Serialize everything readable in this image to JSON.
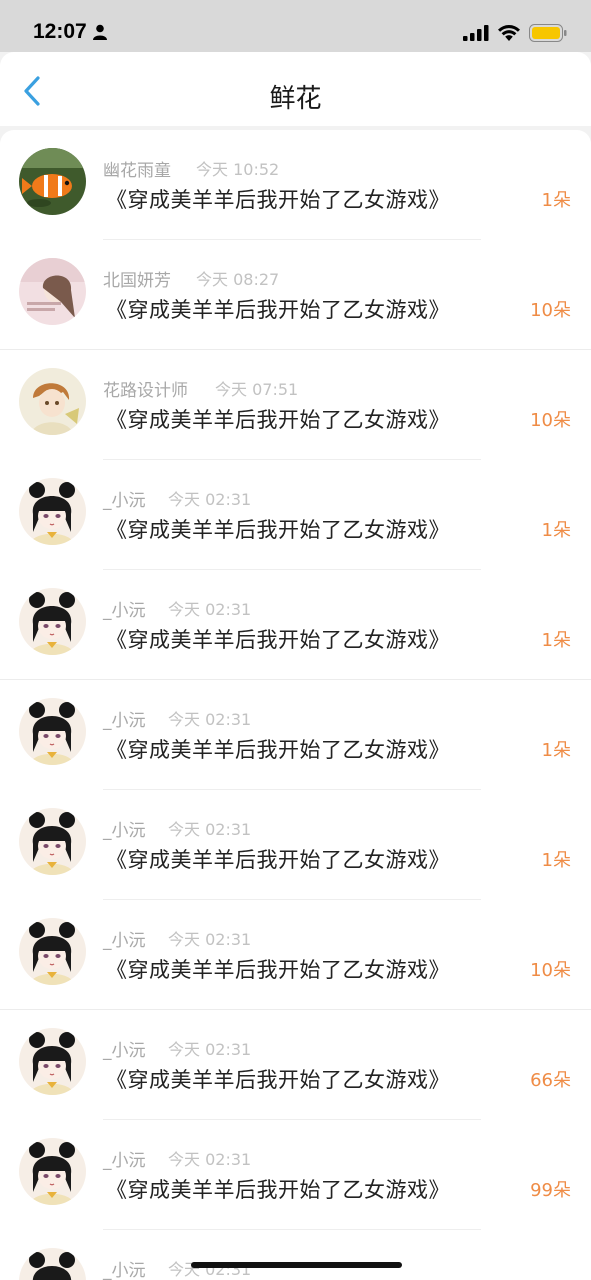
{
  "status_bar": {
    "time": "12:07"
  },
  "header": {
    "title": "鲜花"
  },
  "colors": {
    "accent": "#3aa0e0",
    "count": "#ef8c46"
  },
  "items": [
    {
      "user": "幽花雨童",
      "time": "今天 10:52",
      "book": "《穿成美羊羊后我开始了乙女游戏》",
      "count": "1朵",
      "avatar": "fish"
    },
    {
      "user": "北国妍芳",
      "time": "今天 08:27",
      "book": "《穿成美羊羊后我开始了乙女游戏》",
      "count": "10朵",
      "avatar": "girl-pink"
    },
    {
      "user": "花路设计师",
      "time": "今天 07:51",
      "book": "《穿成美羊羊后我开始了乙女游戏》",
      "count": "10朵",
      "avatar": "boy-anime"
    },
    {
      "user": "_小沅",
      "time": "今天 02:31",
      "book": "《穿成美羊羊后我开始了乙女游戏》",
      "count": "1朵",
      "avatar": "girl-anime"
    },
    {
      "user": "_小沅",
      "time": "今天 02:31",
      "book": "《穿成美羊羊后我开始了乙女游戏》",
      "count": "1朵",
      "avatar": "girl-anime"
    },
    {
      "user": "_小沅",
      "time": "今天 02:31",
      "book": "《穿成美羊羊后我开始了乙女游戏》",
      "count": "1朵",
      "avatar": "girl-anime"
    },
    {
      "user": "_小沅",
      "time": "今天 02:31",
      "book": "《穿成美羊羊后我开始了乙女游戏》",
      "count": "1朵",
      "avatar": "girl-anime"
    },
    {
      "user": "_小沅",
      "time": "今天 02:31",
      "book": "《穿成美羊羊后我开始了乙女游戏》",
      "count": "10朵",
      "avatar": "girl-anime"
    },
    {
      "user": "_小沅",
      "time": "今天 02:31",
      "book": "《穿成美羊羊后我开始了乙女游戏》",
      "count": "66朵",
      "avatar": "girl-anime"
    },
    {
      "user": "_小沅",
      "time": "今天 02:31",
      "book": "《穿成美羊羊后我开始了乙女游戏》",
      "count": "99朵",
      "avatar": "girl-anime"
    },
    {
      "user": "_小沅",
      "time": "今天 02:31",
      "book": "",
      "count": "",
      "avatar": "girl-anime"
    }
  ]
}
